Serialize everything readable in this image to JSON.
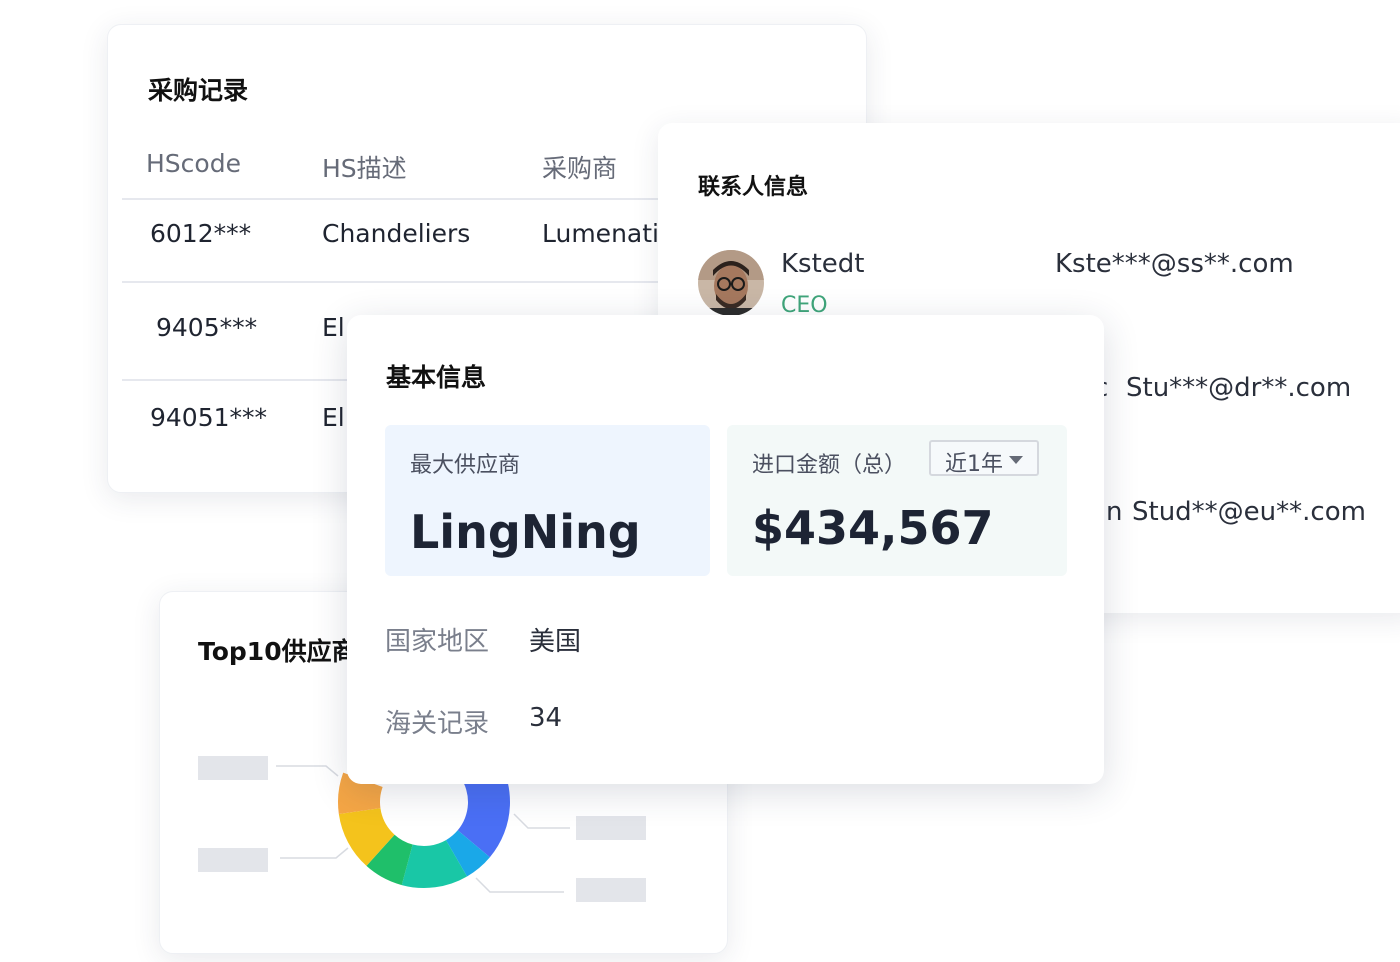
{
  "purchase_records": {
    "title": "采购记录",
    "columns": [
      "HScode",
      "HS描述",
      "采购商"
    ],
    "rows": [
      [
        "6012***",
        "Chandeliers",
        "Lumenati"
      ],
      [
        "9405***",
        "El",
        ""
      ],
      [
        "94051***",
        "El",
        ""
      ]
    ]
  },
  "contacts": {
    "title": "联系人信息",
    "items": [
      {
        "name": "Kstedt",
        "role": "CEO",
        "email": "Kste***@ss**.com"
      },
      {
        "name": "c",
        "role": "",
        "email": "Stu***@dr**.com"
      },
      {
        "name": "n",
        "role": "",
        "email": "Stud**@eu**.com"
      }
    ]
  },
  "top10": {
    "title": "Top10供应商",
    "donut_colors": [
      "#6b57f0",
      "#4a6ff5",
      "#1aa8e8",
      "#19c7a6",
      "#1fbf6a",
      "#f4c31c",
      "#f5a645"
    ]
  },
  "basic_info": {
    "title": "基本信息",
    "top_supplier": {
      "label": "最大供应商",
      "value": "LingNing"
    },
    "import_amount": {
      "label": "进口金额（总）",
      "period": "近1年",
      "value": "$434,567"
    },
    "fields": [
      {
        "label": "国家地区",
        "value": "美国"
      },
      {
        "label": "海关记录",
        "value": "34"
      }
    ]
  },
  "colors": {
    "supplier_box_bg": "#eef5fe",
    "amount_box_bg": "#f3f9f8",
    "role_green": "#3fa57a"
  }
}
